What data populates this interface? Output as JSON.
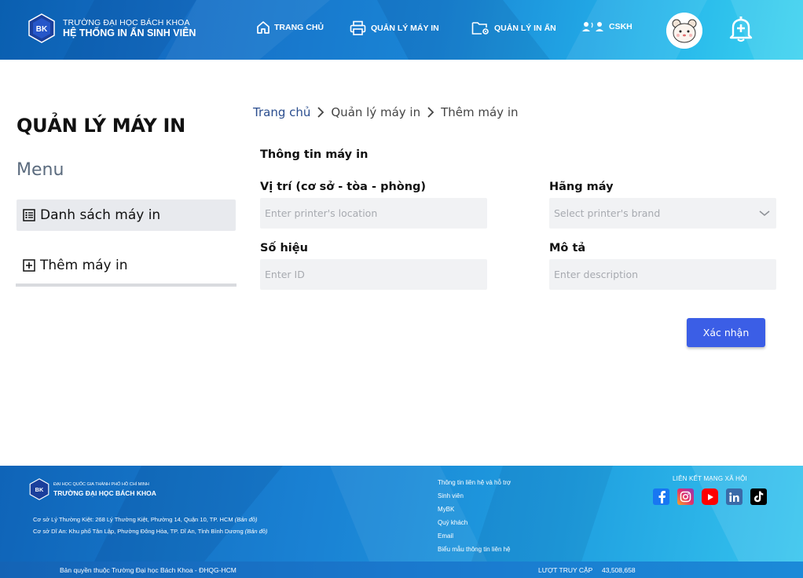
{
  "header": {
    "university_name": "TRƯỜNG ĐẠI HỌC BÁCH KHOA",
    "system_name": "HỆ THỐNG IN ẤN SINH VIÊN",
    "logo_text": "BK",
    "nav": {
      "home": "TRANG CHỦ",
      "printers": "QUẢN LÝ MÁY IN",
      "print_jobs": "QUẢN LÝ IN ẤN",
      "support": "CSKH"
    }
  },
  "sidebar": {
    "title": "QUẢN LÝ MÁY IN",
    "menu_label": "Menu",
    "items": [
      {
        "label": "Danh sách máy in",
        "active": true
      },
      {
        "label": "Thêm máy in",
        "active": false
      }
    ]
  },
  "breadcrumb": [
    "Trang chủ",
    "Quản lý máy in",
    "Thêm máy in"
  ],
  "form": {
    "section_title": "Thông tin máy in",
    "location_label": "Vị trí (cơ sở - tòa - phòng)",
    "location_placeholder": "Enter printer's location",
    "brand_label": "Hãng máy",
    "brand_placeholder": "Select printer's brand",
    "id_label": "Số hiệu",
    "id_placeholder": "Enter ID",
    "description_label": "Mô tả",
    "description_placeholder": "Enter description",
    "submit_label": "Xác nhận"
  },
  "footer": {
    "org_line1": "ĐẠI HỌC QUỐC GIA THÀNH PHỐ HỒ CHÍ MINH",
    "org_line2": "TRƯỜNG ĐẠI HỌC BÁCH KHOA",
    "address1": "Cơ sở Lý Thường Kiệt: 268 Lý Thường Kiệt, Phường 14, Quận 10, TP. HCM",
    "address1_map": "(Bản đồ)",
    "address2": "Cơ sở Dĩ An: Khu phố Tân Lập, Phường Đông Hòa, TP. Dĩ An, Tỉnh Bình Dương",
    "address2_map": "(Bản đồ)",
    "links": [
      "Thông tin liên hệ và hỗ trợ",
      "Sinh viên",
      "MyBK",
      "Quý khách",
      "Email",
      "Biểu mẫu thông tin liên hệ"
    ],
    "social_title": "LIÊN KẾT MẠNG XÃ HỘI",
    "social": [
      "facebook-icon",
      "instagram-icon",
      "youtube-icon",
      "linkedin-icon",
      "tiktok-icon"
    ],
    "copyright": "Bản quyền thuộc Trường Đại học Bách Khoa - ĐHQG-HCM",
    "visits_label": "LƯỢT TRUY CẬP",
    "visits_count": "43,508,658"
  },
  "colors": {
    "primary_button": "#3b5ee6",
    "header_blue": "#1670c7",
    "input_bg": "#f1f2f4",
    "active_menu_bg": "#e8eaee"
  }
}
